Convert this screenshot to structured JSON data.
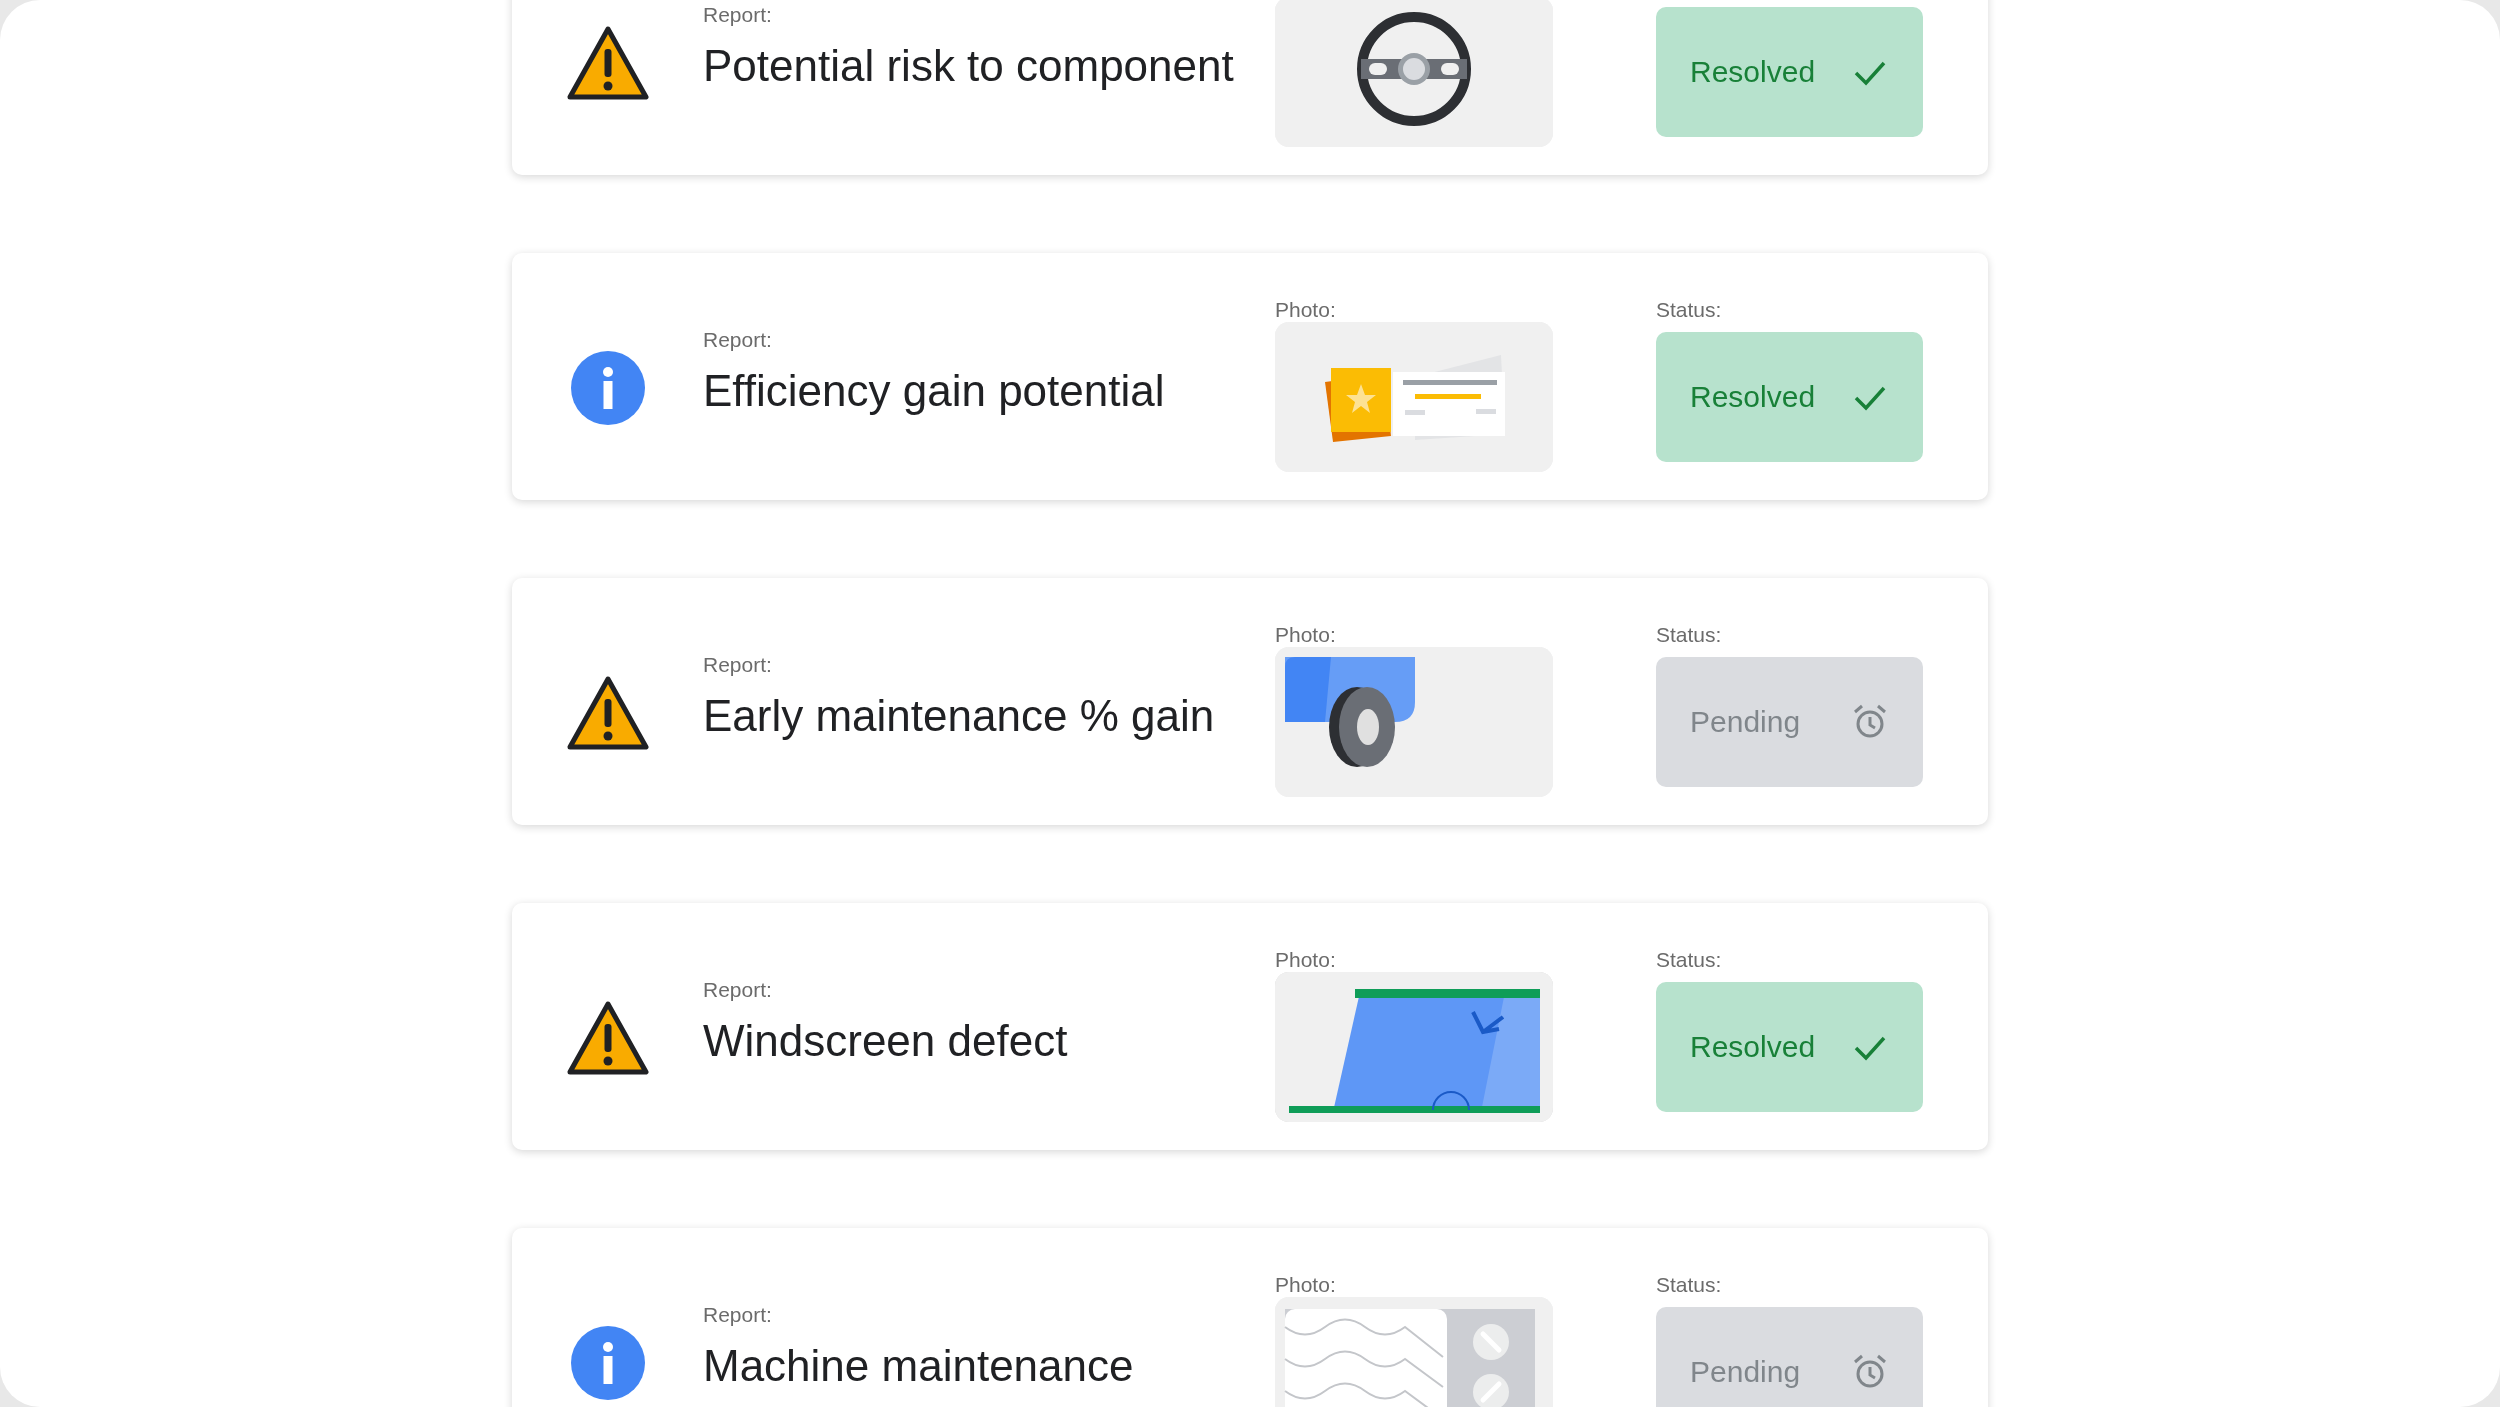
{
  "reports": [
    {
      "kind": "warning",
      "report_label": "Report:",
      "title": "Potential risk to component",
      "photo": {
        "kind": "steering-wheel"
      },
      "status": {
        "kind": "resolved",
        "label": "Resolved"
      }
    },
    {
      "kind": "info",
      "report_label": "Report:",
      "title": "Efficiency gain potential",
      "photo_label": "Photo:",
      "photo": {
        "kind": "ticket"
      },
      "status_label": "Status:",
      "status": {
        "kind": "resolved",
        "label": "Resolved"
      }
    },
    {
      "kind": "warning",
      "report_label": "Report:",
      "title": "Early maintenance % gain",
      "photo_label": "Photo:",
      "photo": {
        "kind": "wheel"
      },
      "status_label": "Status:",
      "status": {
        "kind": "pending",
        "label": "Pending"
      }
    },
    {
      "kind": "warning",
      "report_label": "Report:",
      "title": "Windscreen defect",
      "photo_label": "Photo:",
      "photo": {
        "kind": "windscreen"
      },
      "status_label": "Status:",
      "status": {
        "kind": "resolved",
        "label": "Resolved"
      }
    },
    {
      "kind": "info",
      "report_label": "Report:",
      "title": "Machine maintenance",
      "photo_label": "Photo:",
      "photo": {
        "kind": "panel"
      },
      "status_label": "Status:",
      "status": {
        "kind": "pending",
        "label": "Pending"
      }
    }
  ]
}
